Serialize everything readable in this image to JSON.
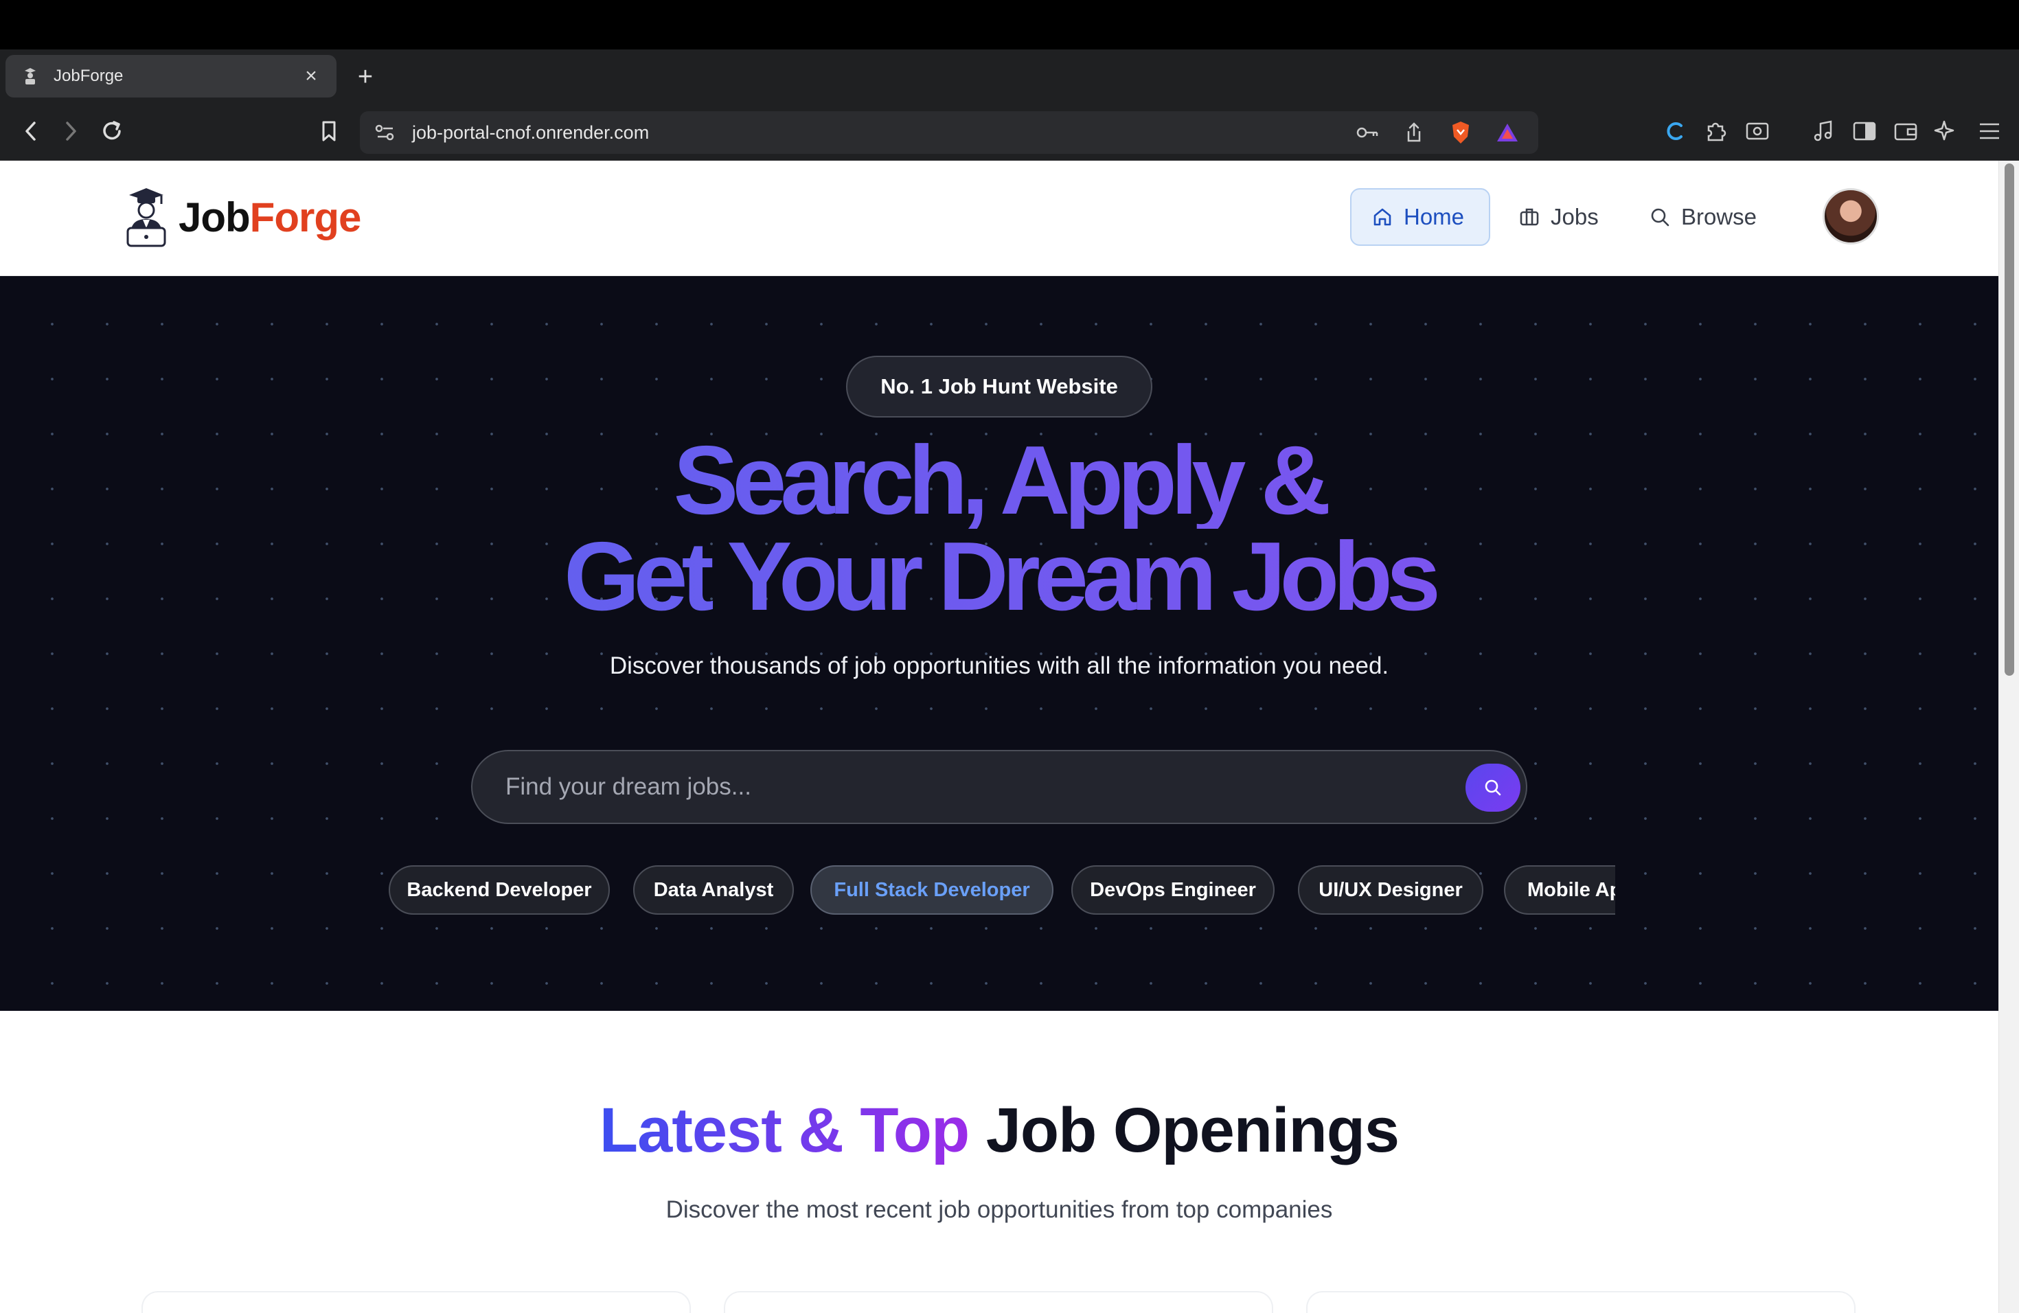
{
  "browser": {
    "tab_title": "JobForge",
    "new_tab_symbol": "+",
    "close_symbol": "×",
    "url": "job-portal-cnof.onrender.com"
  },
  "navbar": {
    "logo_job": "Job",
    "logo_forge": "Forge",
    "items": [
      {
        "label": "Home",
        "icon": "home-icon",
        "active": true
      },
      {
        "label": "Jobs",
        "icon": "briefcase-icon",
        "active": false
      },
      {
        "label": "Browse",
        "icon": "search-icon",
        "active": false
      }
    ]
  },
  "hero": {
    "badge": "No. 1 Job Hunt Website",
    "headline_line1": "Search, Apply &",
    "headline_line2": "Get Your Dream Jobs",
    "subheadline": "Discover thousands of job opportunities with all the information you need.",
    "search_placeholder": "Find your dream jobs...",
    "categories": [
      {
        "label": "Backend Developer",
        "active": false
      },
      {
        "label": "Data Analyst",
        "active": false
      },
      {
        "label": "Full Stack Developer",
        "active": true
      },
      {
        "label": "DevOps Engineer",
        "active": false
      },
      {
        "label": "UI/UX Designer",
        "active": false
      },
      {
        "label": "Mobile Ap",
        "active": false
      }
    ]
  },
  "section": {
    "title_gradient": "Latest & Top",
    "title_plain": "Job Openings",
    "subtitle": "Discover the most recent job opportunities from top companies"
  },
  "colors": {
    "brand_orange": "#e1401f",
    "hero_bg": "#0b0c17",
    "accent_purple": "#7a3cf0",
    "active_nav_bg": "#e7f0fc",
    "active_chip_text": "#6aa0f8"
  }
}
